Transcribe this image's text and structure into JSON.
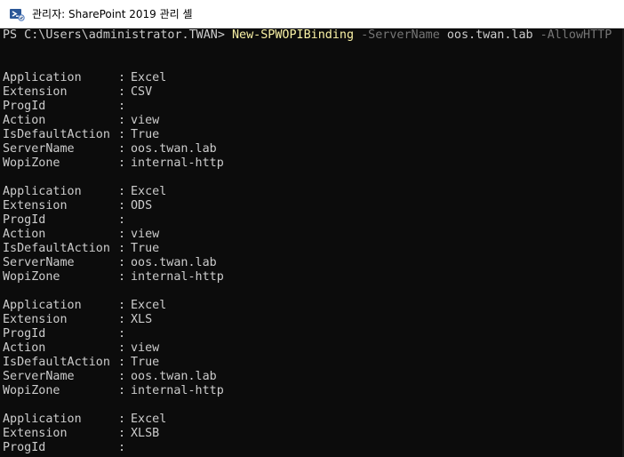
{
  "window": {
    "title": "관리자: SharePoint 2019 관리 셸",
    "icon": "powershell-icon"
  },
  "prompt": {
    "path": "PS C:\\Users\\administrator.TWAN>",
    "cmdlet": "New-SPWOPIBinding",
    "param1": "-ServerName",
    "arg1": "oos.twan.lab",
    "param2": "-AllowHTTP"
  },
  "records": [
    {
      "fields": [
        {
          "key": "Application",
          "value": "Excel"
        },
        {
          "key": "Extension",
          "value": "CSV"
        },
        {
          "key": "ProgId",
          "value": ""
        },
        {
          "key": "Action",
          "value": "view"
        },
        {
          "key": "IsDefaultAction",
          "value": "True"
        },
        {
          "key": "ServerName",
          "value": "oos.twan.lab"
        },
        {
          "key": "WopiZone",
          "value": "internal-http"
        }
      ]
    },
    {
      "fields": [
        {
          "key": "Application",
          "value": "Excel"
        },
        {
          "key": "Extension",
          "value": "ODS"
        },
        {
          "key": "ProgId",
          "value": ""
        },
        {
          "key": "Action",
          "value": "view"
        },
        {
          "key": "IsDefaultAction",
          "value": "True"
        },
        {
          "key": "ServerName",
          "value": "oos.twan.lab"
        },
        {
          "key": "WopiZone",
          "value": "internal-http"
        }
      ]
    },
    {
      "fields": [
        {
          "key": "Application",
          "value": "Excel"
        },
        {
          "key": "Extension",
          "value": "XLS"
        },
        {
          "key": "ProgId",
          "value": ""
        },
        {
          "key": "Action",
          "value": "view"
        },
        {
          "key": "IsDefaultAction",
          "value": "True"
        },
        {
          "key": "ServerName",
          "value": "oos.twan.lab"
        },
        {
          "key": "WopiZone",
          "value": "internal-http"
        }
      ]
    },
    {
      "fields": [
        {
          "key": "Application",
          "value": "Excel"
        },
        {
          "key": "Extension",
          "value": "XLSB"
        },
        {
          "key": "ProgId",
          "value": ""
        }
      ]
    }
  ],
  "separator": ":",
  "colors": {
    "console_bg": "#0c0c0c",
    "text": "#cccccc",
    "cmdlet": "#f9f1a5",
    "param": "#767676"
  }
}
